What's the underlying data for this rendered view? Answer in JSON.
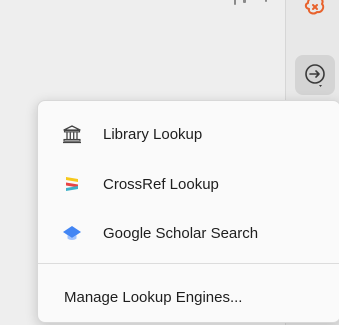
{
  "menu": {
    "items": [
      {
        "label": "Library Lookup",
        "icon": "library-icon"
      },
      {
        "label": "CrossRef Lookup",
        "icon": "crossref-icon"
      },
      {
        "label": "Google Scholar Search",
        "icon": "google-scholar-icon"
      }
    ],
    "manage_label": "Manage Lookup Engines..."
  },
  "sidenav": {
    "top_icon": "chat-icon",
    "locate_icon": "locate-icon"
  },
  "colors": {
    "accent_orange": "#e8622c",
    "crossref_yellow": "#f6c81b",
    "crossref_red": "#e84545",
    "crossref_blue": "#3eb1c8",
    "scholar_blue": "#4285f4",
    "scholar_light_blue": "#a0c3ff"
  }
}
